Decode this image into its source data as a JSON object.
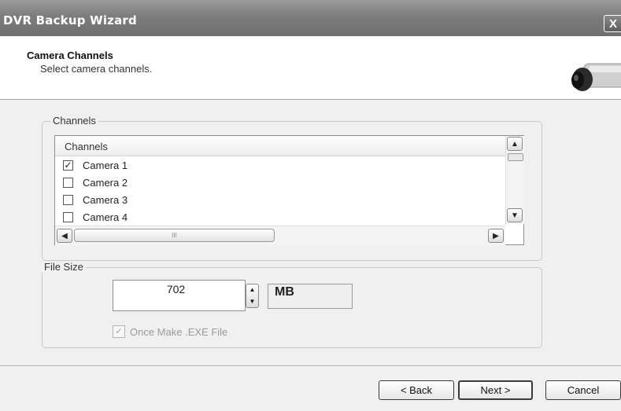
{
  "window": {
    "title": "DVR Backup Wizard",
    "close_glyph": "X"
  },
  "header": {
    "title": "Camera Channels",
    "subtitle": "Select camera channels.",
    "icon": "camera-icon"
  },
  "channels_group": {
    "label": "Channels",
    "list": {
      "column_header": "Channels",
      "items": [
        {
          "label": "Camera 1",
          "checked": true
        },
        {
          "label": "Camera 2",
          "checked": false
        },
        {
          "label": "Camera 3",
          "checked": false
        },
        {
          "label": "Camera 4",
          "checked": false
        }
      ],
      "scroll_up_glyph": "▲",
      "scroll_down_glyph": "▼",
      "scroll_left_glyph": "◀",
      "scroll_right_glyph": "▶",
      "thumb_grip": "III"
    }
  },
  "file_size_group": {
    "label": "File Size",
    "size_value": "702",
    "unit": "MB",
    "spin_up_glyph": "▲",
    "spin_down_glyph": "▼",
    "exe_option": {
      "label": "Once Make .EXE File",
      "checked": true,
      "enabled": false
    }
  },
  "footer": {
    "back_label": "< Back",
    "next_label": "Next >",
    "cancel_label": "Cancel"
  },
  "colors": {
    "titlebar": "#7d7d7d",
    "dialog_bg": "#f0f0f0",
    "header_bg": "#ffffff",
    "disabled_text": "#9a9a9a"
  }
}
